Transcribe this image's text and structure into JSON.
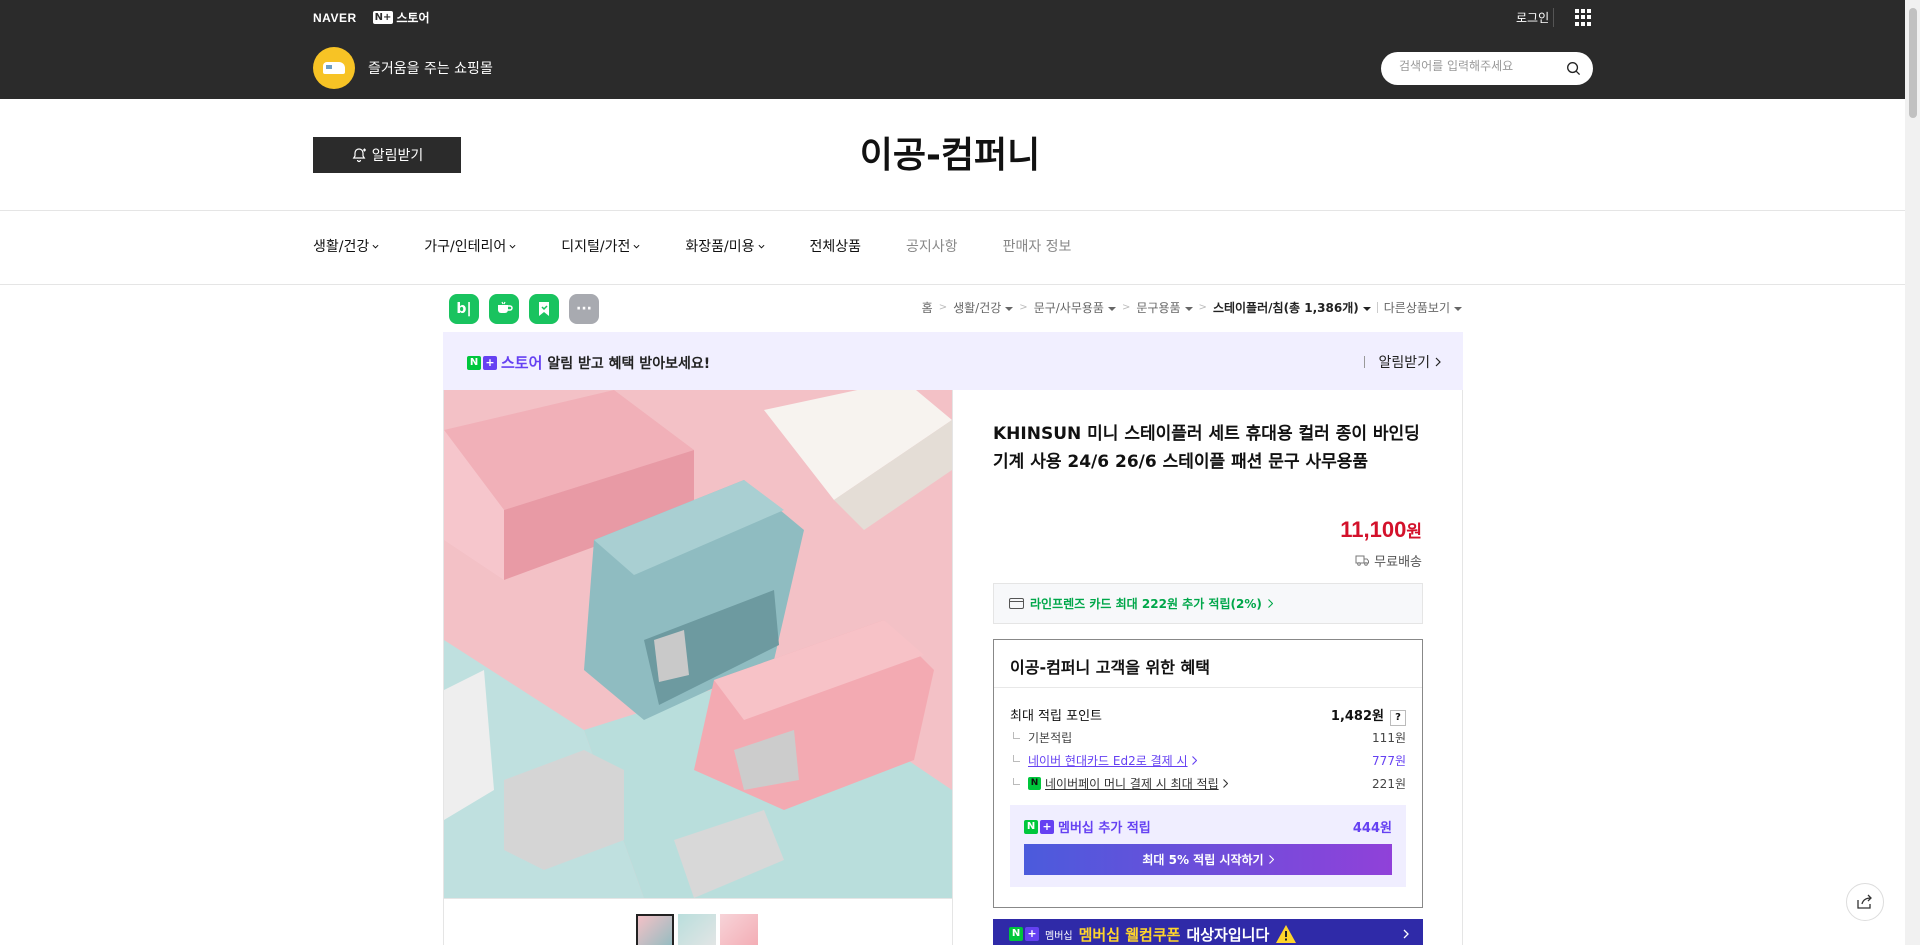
{
  "topbar": {
    "naver_logo": "NAVER",
    "np_logo": "N+",
    "store_label": "스토어",
    "login": "로그인",
    "slogan": "즐거움을 주는 쇼핑몰",
    "search_placeholder": "검색어를 입력해주세요",
    "bg_color": "#2b2b2b"
  },
  "header": {
    "alarm_button": "알림받기",
    "store_name": "이공-컴퍼니"
  },
  "gnb": {
    "items": [
      {
        "label": "생활/건강",
        "dropdown": true
      },
      {
        "label": "가구/인테리어",
        "dropdown": true
      },
      {
        "label": "디지털/가전",
        "dropdown": true
      },
      {
        "label": "화장품/미용",
        "dropdown": true
      },
      {
        "label": "전체상품",
        "dropdown": false
      },
      {
        "label": "공지사항",
        "dropdown": false
      },
      {
        "label": "판매자 정보",
        "dropdown": false
      }
    ]
  },
  "sns": [
    "bl",
    "talk",
    "bookmark",
    "more"
  ],
  "breadcrumb": {
    "home": "홈",
    "c1": "생활/건강",
    "c2": "문구/사무용품",
    "c3": "문구용품",
    "current": "스테이플러/침",
    "count_text": "(총 1,386개)",
    "other": "다른상품보기"
  },
  "banner": {
    "np": "N",
    "plus": "+",
    "store": "스토어",
    "text": "알림 받고 혜택 받아보세요!",
    "action": "알림받기"
  },
  "product": {
    "title": "KHINSUN 미니 스테이플러 세트 휴대용 컬러 종이 바인딩 기계 사용 24/6 26/6 스테이플 패션 문구 사무용품",
    "price": "11,100",
    "currency": "원",
    "shipping": "무료배송",
    "card_promo": "라인프렌즈 카드 최대 222원 추가 적립(2%)",
    "price_color": "#d3112b"
  },
  "benefit": {
    "title": "이공-컴퍼니 고객을 위한 혜택",
    "max_points_label": "최대 적립 포인트",
    "max_points_value": "1,482원",
    "help": "?",
    "basic_label": "기본적립",
    "basic_value": "111원",
    "card_label": "네이버 현대카드 Ed2로 결제 시",
    "card_value": "777원",
    "pay_label": "네이버페이 머니 결제 시 최대 적립",
    "pay_value": "221원",
    "membership_label": "멤버십 추가 적립",
    "membership_value": "444원",
    "cta": "최대 5% 적립 시작하기"
  },
  "coupon": {
    "badge": "멤버십",
    "highlight": "멤버십 웰컴쿠폰",
    "text": "대상자입니다"
  }
}
